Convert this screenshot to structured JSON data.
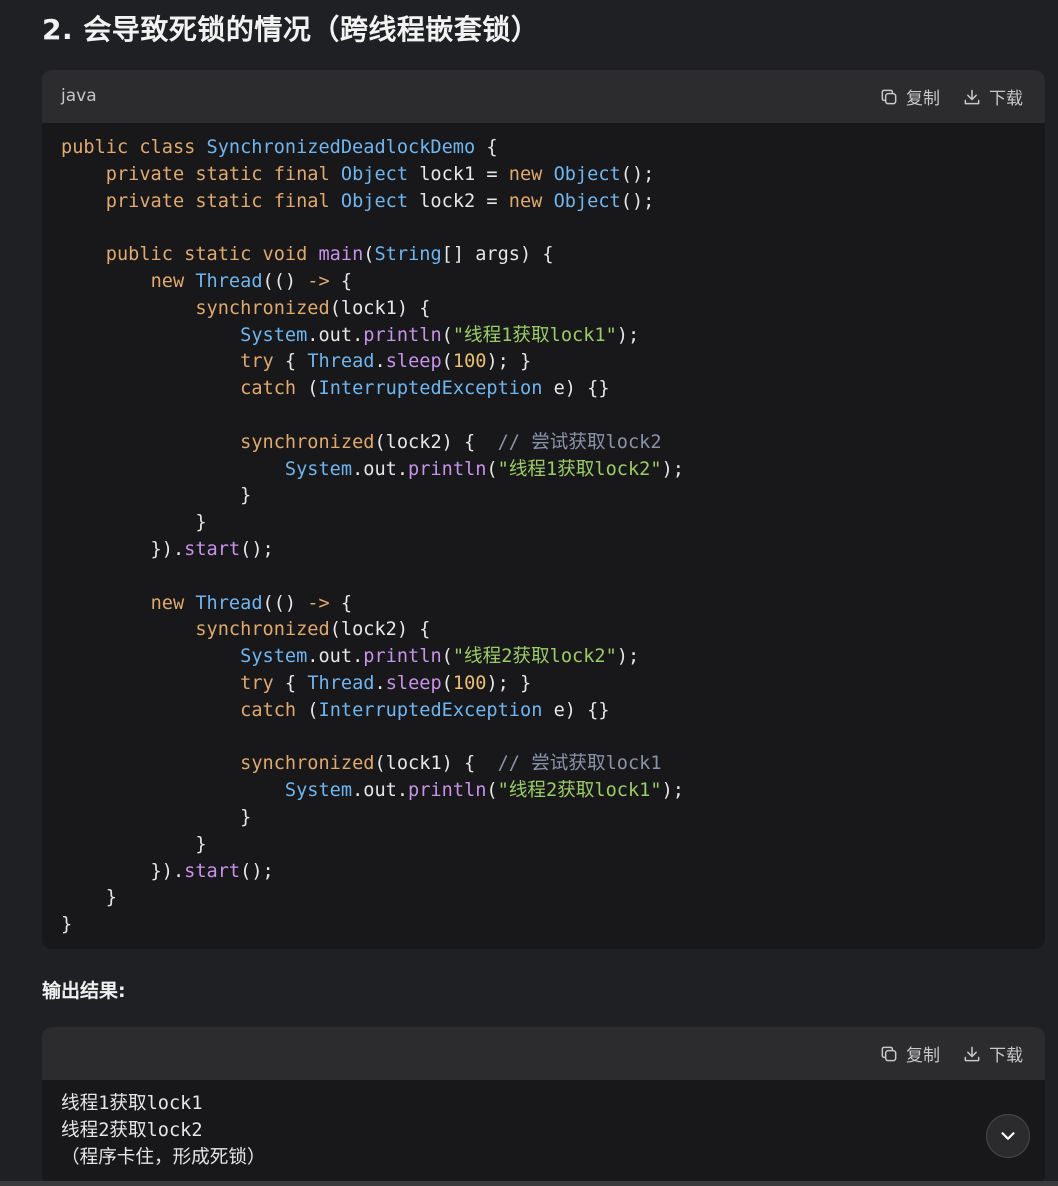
{
  "heading": "2. 会导致死锁的情况（跨线程嵌套锁）",
  "code_block": {
    "language": "java",
    "copy_label": "复制",
    "download_label": "下载",
    "lines": [
      [
        [
          "kw",
          "public class "
        ],
        [
          "type",
          "SynchronizedDeadlockDemo"
        ],
        [
          "pl",
          " {"
        ]
      ],
      [
        [
          "pl",
          "    "
        ],
        [
          "kw",
          "private static final "
        ],
        [
          "type",
          "Object"
        ],
        [
          "pl",
          " lock1 = "
        ],
        [
          "kw",
          "new "
        ],
        [
          "type",
          "Object"
        ],
        [
          "pl",
          "();"
        ]
      ],
      [
        [
          "pl",
          "    "
        ],
        [
          "kw",
          "private static final "
        ],
        [
          "type",
          "Object"
        ],
        [
          "pl",
          " lock2 = "
        ],
        [
          "kw",
          "new "
        ],
        [
          "type",
          "Object"
        ],
        [
          "pl",
          "();"
        ]
      ],
      [],
      [
        [
          "pl",
          "    "
        ],
        [
          "kw",
          "public static void "
        ],
        [
          "fn",
          "main"
        ],
        [
          "pl",
          "("
        ],
        [
          "type",
          "String"
        ],
        [
          "pl",
          "[] args) {"
        ]
      ],
      [
        [
          "pl",
          "        "
        ],
        [
          "kw",
          "new "
        ],
        [
          "type",
          "Thread"
        ],
        [
          "pl",
          "(() "
        ],
        [
          "kw",
          "->"
        ],
        [
          "pl",
          " {"
        ]
      ],
      [
        [
          "pl",
          "            "
        ],
        [
          "kw",
          "synchronized"
        ],
        [
          "pl",
          "(lock1) {"
        ]
      ],
      [
        [
          "pl",
          "                "
        ],
        [
          "type",
          "System"
        ],
        [
          "pl",
          ".out."
        ],
        [
          "fn",
          "println"
        ],
        [
          "pl",
          "("
        ],
        [
          "str",
          "\"线程1获取lock1\""
        ],
        [
          "pl",
          ");"
        ]
      ],
      [
        [
          "pl",
          "                "
        ],
        [
          "kw",
          "try"
        ],
        [
          "pl",
          " { "
        ],
        [
          "type",
          "Thread"
        ],
        [
          "pl",
          "."
        ],
        [
          "fn",
          "sleep"
        ],
        [
          "pl",
          "("
        ],
        [
          "num",
          "100"
        ],
        [
          "pl",
          "); }"
        ]
      ],
      [
        [
          "pl",
          "                "
        ],
        [
          "kw",
          "catch"
        ],
        [
          "pl",
          " ("
        ],
        [
          "type",
          "InterruptedException"
        ],
        [
          "pl",
          " e) {}"
        ]
      ],
      [],
      [
        [
          "pl",
          "                "
        ],
        [
          "kw",
          "synchronized"
        ],
        [
          "pl",
          "(lock2) {  "
        ],
        [
          "cm",
          "// 尝试获取lock2"
        ]
      ],
      [
        [
          "pl",
          "                    "
        ],
        [
          "type",
          "System"
        ],
        [
          "pl",
          ".out."
        ],
        [
          "fn",
          "println"
        ],
        [
          "pl",
          "("
        ],
        [
          "str",
          "\"线程1获取lock2\""
        ],
        [
          "pl",
          ");"
        ]
      ],
      [
        [
          "pl",
          "                }"
        ]
      ],
      [
        [
          "pl",
          "            }"
        ]
      ],
      [
        [
          "pl",
          "        })."
        ],
        [
          "fn",
          "start"
        ],
        [
          "pl",
          "();"
        ]
      ],
      [],
      [
        [
          "pl",
          "        "
        ],
        [
          "kw",
          "new "
        ],
        [
          "type",
          "Thread"
        ],
        [
          "pl",
          "(() "
        ],
        [
          "kw",
          "->"
        ],
        [
          "pl",
          " {"
        ]
      ],
      [
        [
          "pl",
          "            "
        ],
        [
          "kw",
          "synchronized"
        ],
        [
          "pl",
          "(lock2) {"
        ]
      ],
      [
        [
          "pl",
          "                "
        ],
        [
          "type",
          "System"
        ],
        [
          "pl",
          ".out."
        ],
        [
          "fn",
          "println"
        ],
        [
          "pl",
          "("
        ],
        [
          "str",
          "\"线程2获取lock2\""
        ],
        [
          "pl",
          ");"
        ]
      ],
      [
        [
          "pl",
          "                "
        ],
        [
          "kw",
          "try"
        ],
        [
          "pl",
          " { "
        ],
        [
          "type",
          "Thread"
        ],
        [
          "pl",
          "."
        ],
        [
          "fn",
          "sleep"
        ],
        [
          "pl",
          "("
        ],
        [
          "num",
          "100"
        ],
        [
          "pl",
          "); }"
        ]
      ],
      [
        [
          "pl",
          "                "
        ],
        [
          "kw",
          "catch"
        ],
        [
          "pl",
          " ("
        ],
        [
          "type",
          "InterruptedException"
        ],
        [
          "pl",
          " e) {}"
        ]
      ],
      [],
      [
        [
          "pl",
          "                "
        ],
        [
          "kw",
          "synchronized"
        ],
        [
          "pl",
          "(lock1) {  "
        ],
        [
          "cm",
          "// 尝试获取lock1"
        ]
      ],
      [
        [
          "pl",
          "                    "
        ],
        [
          "type",
          "System"
        ],
        [
          "pl",
          ".out."
        ],
        [
          "fn",
          "println"
        ],
        [
          "pl",
          "("
        ],
        [
          "str",
          "\"线程2获取lock1\""
        ],
        [
          "pl",
          ");"
        ]
      ],
      [
        [
          "pl",
          "                }"
        ]
      ],
      [
        [
          "pl",
          "            }"
        ]
      ],
      [
        [
          "pl",
          "        })."
        ],
        [
          "fn",
          "start"
        ],
        [
          "pl",
          "();"
        ]
      ],
      [
        [
          "pl",
          "    }"
        ]
      ],
      [
        [
          "pl",
          "}"
        ]
      ]
    ]
  },
  "output_label": "输出结果:",
  "output_block": {
    "copy_label": "复制",
    "download_label": "下载",
    "lines": [
      "线程1获取lock1",
      "线程2获取lock2",
      "（程序卡住，形成死锁）"
    ]
  },
  "icons": {
    "copy": "copy-icon",
    "download": "download-icon",
    "scroll_down": "chevron-down-icon"
  }
}
